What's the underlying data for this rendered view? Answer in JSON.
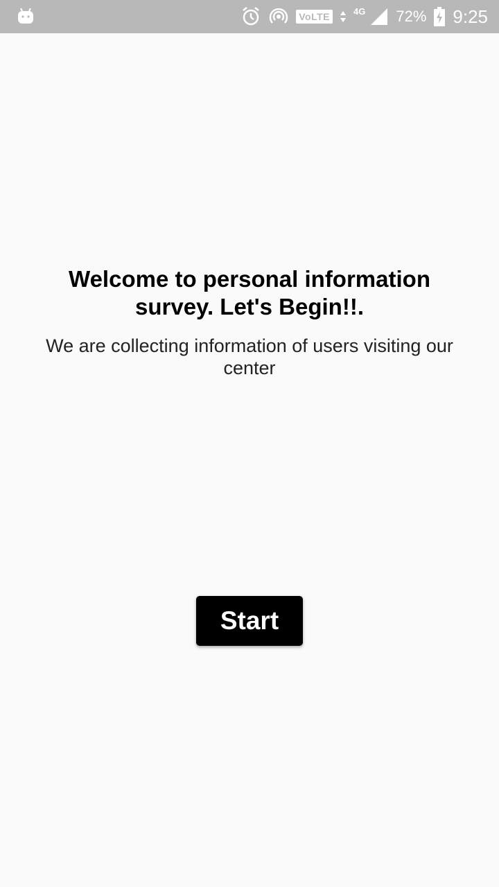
{
  "status_bar": {
    "left_icon": "android-notification-icon",
    "alarm_icon": "alarm-clock-icon",
    "hotspot_icon": "hotspot-icon",
    "volte_label": "VoLTE",
    "network_type": "4G",
    "signal_icon": "cell-signal-icon",
    "battery_percent": "72%",
    "battery_icon": "battery-charging-icon",
    "time": "9:25",
    "background_color": "#b8b8b8"
  },
  "main": {
    "title": "Welcome to personal information survey. Let's Begin!!.",
    "subtitle": "We are collecting information of users visiting our center",
    "start_button_label": "Start"
  },
  "colors": {
    "background": "#fafafa",
    "button_bg": "#000000",
    "button_text": "#ffffff"
  }
}
